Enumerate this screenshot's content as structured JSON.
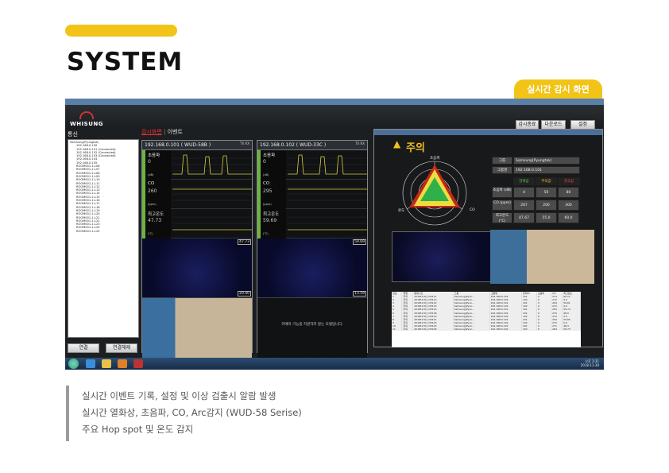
{
  "page": {
    "title": "SYSTEM",
    "badge": "실시간 감시 화면",
    "desc": [
      "실시간 이벤트 기록, 설정 및 이상 검출시 알람 발생",
      "실시간 열화상, 초음파, CO, Arc감지 (WUD-58 Serise)",
      "주요 Hop spot 및 온도 감지"
    ]
  },
  "app": {
    "logo": "WHISUNG",
    "header_buttons": [
      "감시종료",
      "다운로드",
      "설정"
    ],
    "left_title": "통신",
    "tree": [
      "Samsung(Pyungtak)",
      "192.168.0.100",
      "192.168.0.101 (Connected)",
      "192.168.0.102 (Connected)",
      "192.168.0.103 (Connected)",
      "192.168.0.104",
      "192.168.0.105",
      "ROOM001-1-L08",
      "ROOM001-1-L07",
      "ROOM001-1-L08",
      "ROOM001-1-L09",
      "ROOM001-1-L10",
      "ROOM001-1-L11",
      "ROOM001-1-L12",
      "ROOM001-1-L13",
      "ROOM001-1-L14",
      "ROOM001-1-L15",
      "ROOM001-1-L16",
      "ROOM001-1-L17",
      "ROOM001-1-L18",
      "ROOM001-1-L19",
      "ROOM001-1-L20",
      "ROOM001-1-L21",
      "ROOM001-1-L22",
      "ROOM001-1-L23",
      "ROOM001-1-L24",
      "ROOM001-1-L25"
    ],
    "left_buttons": [
      "연결",
      "연결해제"
    ],
    "tabs": [
      "감시화면",
      "이벤트"
    ],
    "devices": [
      {
        "name": "192.168.0.101 ( WUD-58B )",
        "icons": "TX RX",
        "metrics": [
          {
            "label": "초음파",
            "value": "0",
            "unit": "(dB)"
          },
          {
            "label": "CO",
            "value": "260",
            "unit": "(ppm)"
          },
          {
            "label": "최고온도",
            "value": "47.73",
            "unit": "(℃)"
          }
        ],
        "therm_max": "47.73",
        "therm_min": "20.40",
        "cam_note": ""
      },
      {
        "name": "192.168.0.102 ( WUD-33C )",
        "icons": "TX RX",
        "metrics": [
          {
            "label": "초음파",
            "value": "0",
            "unit": "(dB)"
          },
          {
            "label": "CO",
            "value": "295",
            "unit": "(ppm)"
          },
          {
            "label": "최고온도",
            "value": "59.69",
            "unit": "(℃)"
          }
        ],
        "therm_max": "59.69",
        "therm_min": "13.59",
        "cam_note": "카메라 기능을 지원하지 않는 모델입니다."
      }
    ],
    "popup": {
      "warning": "주의",
      "radar_labels": [
        "초음파",
        "CO",
        "온도"
      ],
      "group_label": "그룹",
      "group_value": "Samsung(Pyungtak)",
      "groupname_label": "그룹명",
      "groupname_value": "192.168.0.101",
      "thresholds": [
        "현재값",
        "주의값",
        "경고값"
      ],
      "rows": [
        {
          "label": "초음파 (dB)",
          "vals": [
            "4",
            "50",
            "80"
          ]
        },
        {
          "label": "CO (ppm)",
          "vals": [
            "267",
            "200",
            "300"
          ]
        },
        {
          "label": "최고온도 (℃)",
          "vals": [
            "47.67",
            "55.0",
            "60.0"
          ]
        }
      ],
      "table_headers": [
        "번호",
        "레벨",
        "발생시간",
        "그룹",
        "그룹명",
        "장치ID",
        "초음파",
        "CO",
        "최고온도"
      ],
      "table_rows": [
        [
          "1",
          "주의",
          "20181130_133111",
          "Samsung(Pyun...",
          "192.168.0.101",
          "101",
          "0",
          "274",
          "60.11"
        ],
        [
          "2",
          "주의",
          "20181130_133112",
          "Samsung(Pyun...",
          "192.168.0.102",
          "102",
          "0",
          "272",
          "0.0"
        ],
        [
          "3",
          "주의",
          "20181130_133112",
          "Samsung(Pyun...",
          "192.168.0.101",
          "101",
          "0",
          "264",
          "59.61"
        ],
        [
          "4",
          "주의",
          "20181130_133113",
          "Samsung(Pyun...",
          "192.168.0.102",
          "102",
          "0",
          "272",
          "0.0"
        ],
        [
          "5",
          "주의",
          "20181130_133114",
          "Samsung(Pyun...",
          "192.168.0.101",
          "101",
          "0",
          "264",
          "55.74"
        ],
        [
          "6",
          "주의",
          "20181130_133118",
          "Samsung(Pyun...",
          "192.168.0.101",
          "101",
          "0",
          "270",
          "48.0"
        ],
        [
          "7",
          "주의",
          "20181130_133119",
          "Samsung(Pyun...",
          "192.168.0.102",
          "102",
          "0",
          "272",
          "0.0"
        ],
        [
          "8",
          "주의",
          "20181130_133121",
          "Samsung(Pyun...",
          "192.168.0.101",
          "101",
          "0",
          "264",
          "59.65"
        ],
        [
          "9",
          "주의",
          "20181130_133123",
          "Samsung(Pyun...",
          "192.168.0.102",
          "102",
          "0",
          "272",
          "0.0"
        ],
        [
          "10",
          "주의",
          "20181130_133124",
          "Samsung(Pyun...",
          "192.168.0.101",
          "101",
          "0",
          "271",
          "48.3"
        ],
        [
          "11",
          "주의",
          "20181130_133126",
          "Samsung(Pyun...",
          "192.168.0.102",
          "102",
          "0",
          "264",
          "59.73"
        ]
      ]
    },
    "clock": [
      "오후 3:31",
      "2018-11-30"
    ]
  },
  "colors": {
    "accent": "#f2c417",
    "metric_green": "#6db33f",
    "warn": "#f0c020"
  }
}
